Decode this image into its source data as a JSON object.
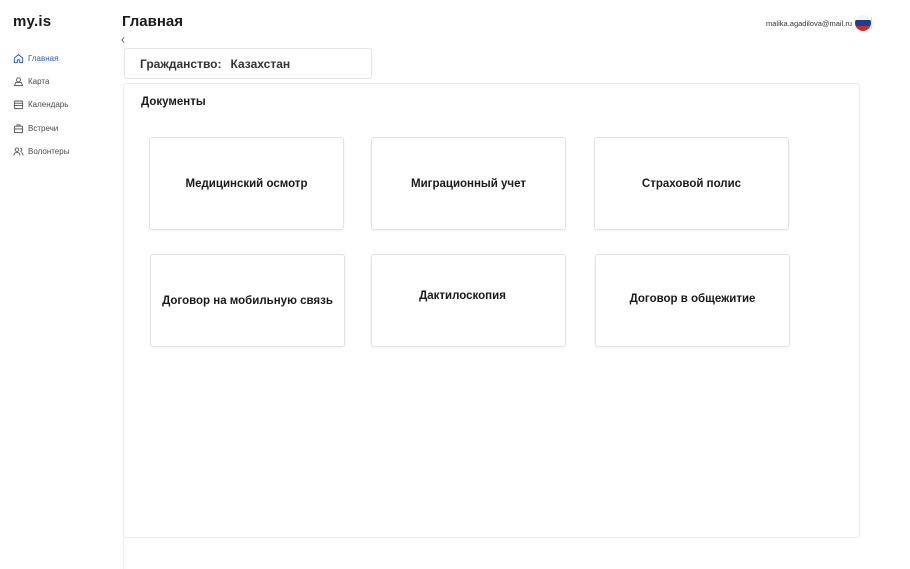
{
  "app": {
    "logo": "my.is"
  },
  "sidebar": {
    "items": [
      {
        "label": "Главная",
        "icon": "home-icon",
        "active": true
      },
      {
        "label": "Карта",
        "icon": "map-icon",
        "active": false
      },
      {
        "label": "Календарь",
        "icon": "calendar-icon",
        "active": false
      },
      {
        "label": "Встречи",
        "icon": "briefcase-icon",
        "active": false
      },
      {
        "label": "Волонтеры",
        "icon": "users-icon",
        "active": false
      }
    ]
  },
  "header": {
    "title": "Главная",
    "user_email": "malika.agadilova@mail.ru",
    "language_flag": "russia-flag-icon"
  },
  "citizenship": {
    "label": "Гражданство:",
    "value": "Казахстан"
  },
  "documents": {
    "title": "Документы",
    "cards": [
      {
        "label": "Медицинский осмотр"
      },
      {
        "label": "Миграционный учет"
      },
      {
        "label": "Страховой полис"
      },
      {
        "label": "Договор на мобильную связь"
      },
      {
        "label": "Дактилоскопия"
      },
      {
        "label": "Договор в общежитие"
      }
    ]
  },
  "colors": {
    "accent": "#2b5fc4",
    "border": "#e2e2e2",
    "text": "#1a1a1a"
  }
}
